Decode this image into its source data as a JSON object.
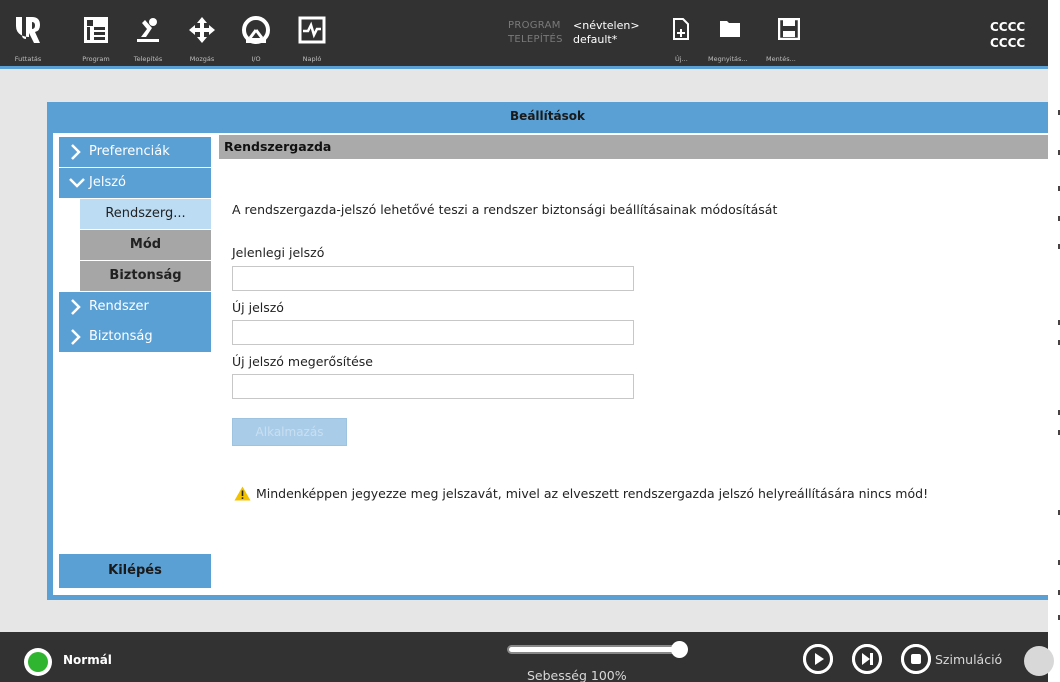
{
  "topbar": {
    "nav": [
      {
        "label": "Futtatás",
        "icon": "ur-logo-icon"
      },
      {
        "label": "Program",
        "icon": "program-icon"
      },
      {
        "label": "Telepítés",
        "icon": "installation-robot-arm-icon"
      },
      {
        "label": "Mozgás",
        "icon": "move-arrows-icon"
      },
      {
        "label": "I/O",
        "icon": "io-gauge-icon"
      },
      {
        "label": "Napló",
        "icon": "log-chart-icon"
      }
    ],
    "program_label": "PROGRAM",
    "program_value": "<névtelen>",
    "installation_label": "TELEPÍTÉS",
    "installation_value": "default*",
    "file_buttons": [
      {
        "label": "Új...",
        "icon": "new-file-icon"
      },
      {
        "label": "Megnyitás...",
        "icon": "open-folder-icon"
      },
      {
        "label": "Mentés...",
        "icon": "save-disk-icon"
      }
    ],
    "right_line1": "CCCC",
    "right_line2": "CCCC"
  },
  "panel": {
    "title": "Beállítások",
    "sidebar": {
      "items": [
        {
          "label": "Preferenciák",
          "expanded": false
        },
        {
          "label": "Jelszó",
          "expanded": true
        },
        {
          "label": "Rendszerg..."
        },
        {
          "label": "Mód"
        },
        {
          "label": "Biztonság"
        },
        {
          "label": "Rendszer",
          "expanded": false
        },
        {
          "label": "Biztonság",
          "expanded": false
        }
      ],
      "logout": "Kilépés"
    },
    "section_title": "Rendszergazda",
    "description": "A rendszergazda-jelszó lehetővé teszi a rendszer biztonsági beállításainak módosítását",
    "fields": {
      "current_label": "Jelenlegi jelszó",
      "current_value": "",
      "new_label": "Új jelszó",
      "new_value": "",
      "confirm_label": "Új jelszó megerősítése",
      "confirm_value": ""
    },
    "apply_button": "Alkalmazás",
    "warning": "Mindenképpen jegyezze meg jelszavát, mivel az elveszett rendszergazda jelszó helyreállítására nincs mód!"
  },
  "bottombar": {
    "status": "Normál",
    "status_color": "#2fb52f",
    "speed_text": "Sebesség 100%",
    "speed_fraction": 1.0,
    "controls": [
      "play-icon",
      "step-icon",
      "stop-icon"
    ],
    "simulation_label": "Szimuláció"
  },
  "colors": {
    "accent": "#5aa0d5",
    "topbar": "#323232",
    "section_header": "#aaaaaa"
  }
}
